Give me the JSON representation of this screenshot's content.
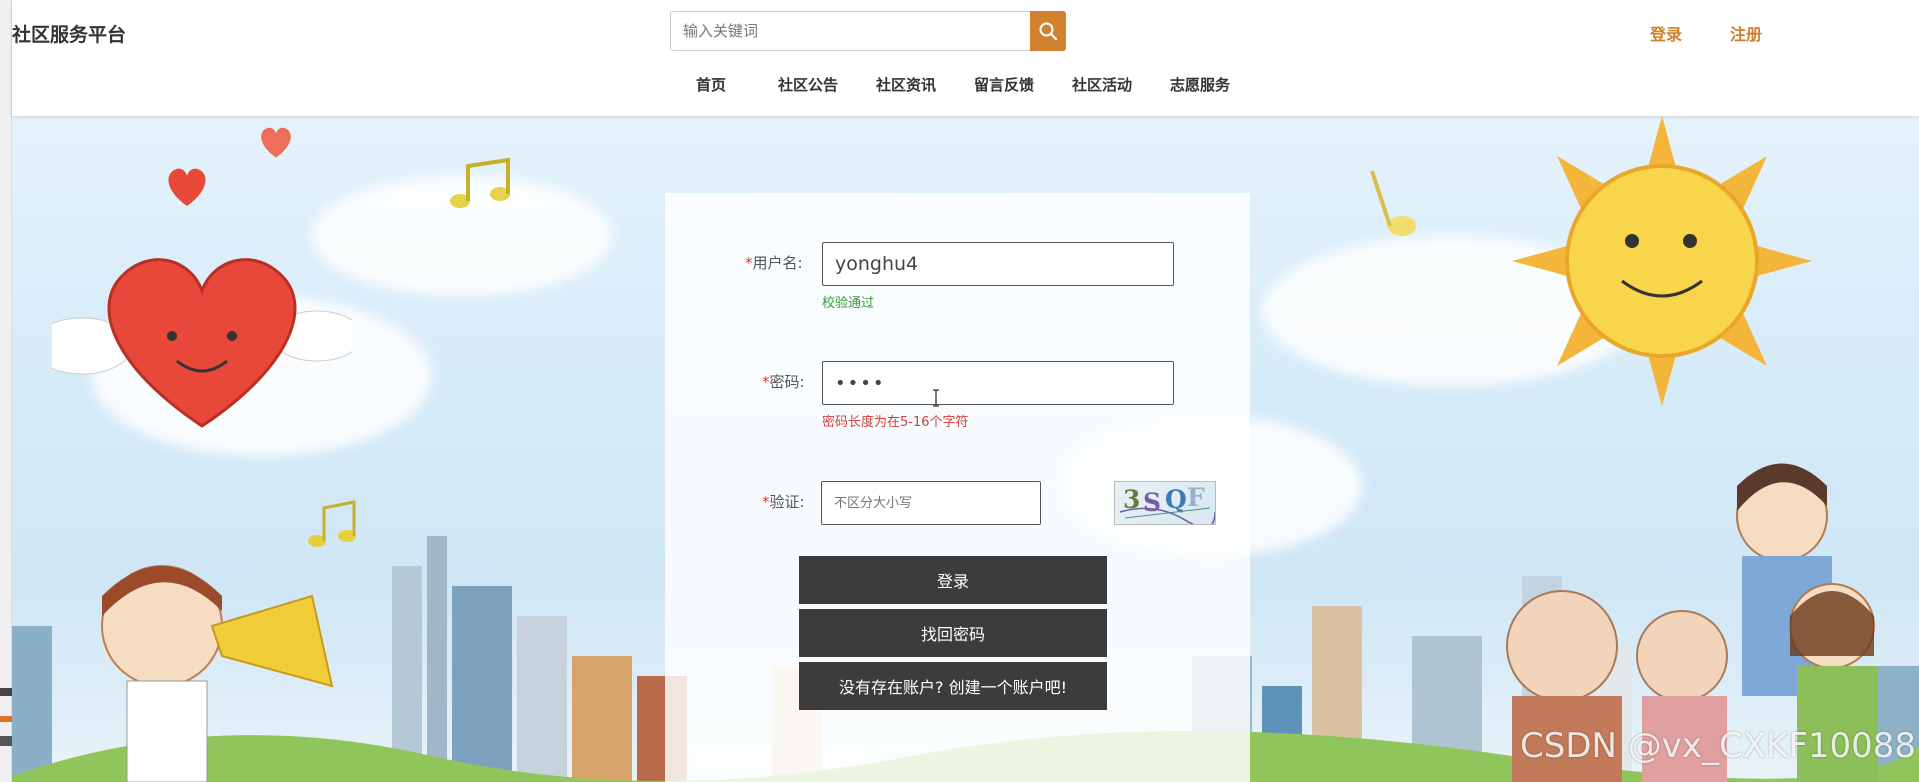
{
  "header": {
    "logo": "社区服务平台",
    "search": {
      "placeholder": "输入关键词",
      "value": ""
    },
    "login_link": "登录",
    "register_link": "注册",
    "nav": [
      "首页",
      "社区公告",
      "社区资讯",
      "留言反馈",
      "社区活动",
      "志愿服务"
    ]
  },
  "form": {
    "username": {
      "label": "用户名:",
      "required": "*",
      "value": "yonghu4",
      "hint": "校验通过"
    },
    "password": {
      "label": "密码:",
      "required": "*",
      "value": "••••",
      "hint": "密码长度为在5-16个字符"
    },
    "captcha": {
      "label": "验证:",
      "required": "*",
      "placeholder": "不区分大小写",
      "image_text": "3SQF"
    },
    "buttons": {
      "login": "登录",
      "recover": "找回密码",
      "create": "没有存在账户? 创建一个账户吧!"
    }
  },
  "watermark": "CSDN @vx_CXKF10088",
  "colors": {
    "accent": "#d2822e",
    "button": "#3c3c3c",
    "ok": "#3a9a3a",
    "error": "#d24040",
    "required": "#e33333"
  }
}
